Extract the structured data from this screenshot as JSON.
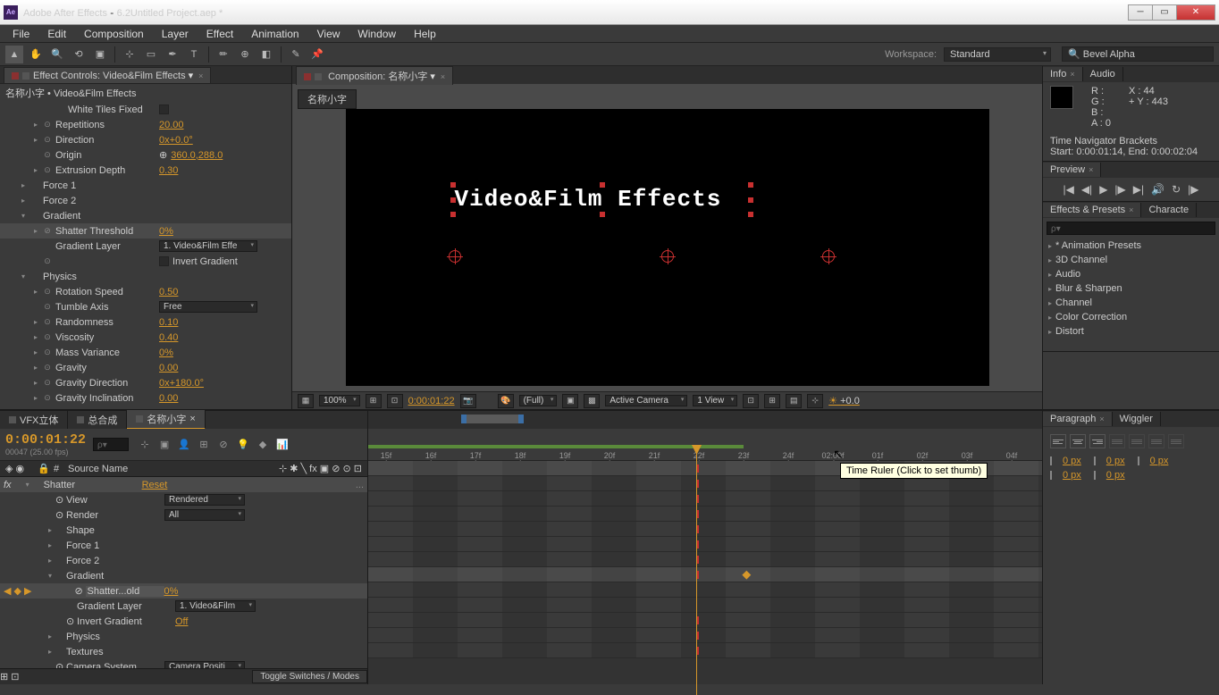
{
  "titlebar": {
    "app": "Adobe After Effects",
    "file": "6.2Untitled Project.aep *"
  },
  "menus": [
    "File",
    "Edit",
    "Composition",
    "Layer",
    "Effect",
    "Animation",
    "View",
    "Window",
    "Help"
  ],
  "toolbar": {
    "workspace_label": "Workspace:",
    "workspace": "Standard",
    "search": "Bevel Alpha"
  },
  "effect_controls": {
    "tab": "Effect Controls: Video&Film Effects",
    "header": "名称小字 • Video&Film Effects",
    "props": [
      {
        "indent": 3,
        "tw": "",
        "sw": "",
        "name": "White Tiles Fixed",
        "valtype": "check"
      },
      {
        "indent": 2,
        "tw": "▸",
        "sw": "⊙",
        "name": "Repetitions",
        "valtype": "hot",
        "val": "20.00"
      },
      {
        "indent": 2,
        "tw": "▸",
        "sw": "⊙",
        "name": "Direction",
        "valtype": "hot",
        "val": "0x+0.0°"
      },
      {
        "indent": 2,
        "tw": "",
        "sw": "⊙",
        "name": "Origin",
        "valtype": "origin",
        "val": "360.0,288.0"
      },
      {
        "indent": 2,
        "tw": "▸",
        "sw": "⊙",
        "name": "Extrusion Depth",
        "valtype": "hot",
        "val": "0.30"
      },
      {
        "indent": 1,
        "tw": "▸",
        "sw": "",
        "name": "Force 1",
        "valtype": "none"
      },
      {
        "indent": 1,
        "tw": "▸",
        "sw": "",
        "name": "Force 2",
        "valtype": "none"
      },
      {
        "indent": 1,
        "tw": "▾",
        "sw": "",
        "name": "Gradient",
        "valtype": "none"
      },
      {
        "indent": 2,
        "tw": "▸",
        "sw": "⊘",
        "name": "Shatter Threshold",
        "valtype": "hot",
        "val": "0%",
        "hi": true
      },
      {
        "indent": 2,
        "tw": "",
        "sw": "",
        "name": "Gradient Layer",
        "valtype": "dd",
        "val": "1. Video&Film Effe"
      },
      {
        "indent": 2,
        "tw": "",
        "sw": "⊙",
        "name": "",
        "valtype": "checklabel",
        "val": "Invert Gradient"
      },
      {
        "indent": 1,
        "tw": "▾",
        "sw": "",
        "name": "Physics",
        "valtype": "none"
      },
      {
        "indent": 2,
        "tw": "▸",
        "sw": "⊙",
        "name": "Rotation Speed",
        "valtype": "hot",
        "val": "0.50"
      },
      {
        "indent": 2,
        "tw": "",
        "sw": "⊙",
        "name": "Tumble Axis",
        "valtype": "dd",
        "val": "Free"
      },
      {
        "indent": 2,
        "tw": "▸",
        "sw": "⊙",
        "name": "Randomness",
        "valtype": "hot",
        "val": "0.10"
      },
      {
        "indent": 2,
        "tw": "▸",
        "sw": "⊙",
        "name": "Viscosity",
        "valtype": "hot",
        "val": "0.40"
      },
      {
        "indent": 2,
        "tw": "▸",
        "sw": "⊙",
        "name": "Mass Variance",
        "valtype": "hot",
        "val": "0%"
      },
      {
        "indent": 2,
        "tw": "▸",
        "sw": "⊙",
        "name": "Gravity",
        "valtype": "hot",
        "val": "0.00"
      },
      {
        "indent": 2,
        "tw": "▸",
        "sw": "⊙",
        "name": "Gravity Direction",
        "valtype": "hot",
        "val": "0x+180.0°"
      },
      {
        "indent": 2,
        "tw": "▸",
        "sw": "⊙",
        "name": "Gravity Inclination",
        "valtype": "hot",
        "val": "0.00"
      }
    ]
  },
  "comp": {
    "tab_prefix": "Composition:",
    "name": "名称小字",
    "text": "Video&Film Effects",
    "footer": {
      "zoom": "100%",
      "time": "0:00:01:22",
      "res": "(Full)",
      "camera": "Active Camera",
      "views": "1 View",
      "exposure": "+0.0"
    }
  },
  "info": {
    "tabs": [
      "Info",
      "Audio"
    ],
    "r": "R :",
    "g": "G :",
    "b": "B :",
    "a": "A : 0",
    "x": "X : 44",
    "y": "Y : 443",
    "nav": "Time Navigator Brackets",
    "nav2": "Start: 0:00:01:14, End: 0:00:02:04"
  },
  "preview": {
    "tab": "Preview"
  },
  "effects_presets": {
    "tabs": [
      "Effects & Presets",
      "Characte"
    ],
    "search": "ρ▾",
    "items": [
      "* Animation Presets",
      "3D Channel",
      "Audio",
      "Blur & Sharpen",
      "Channel",
      "Color Correction",
      "Distort"
    ]
  },
  "paragraph": {
    "tabs": [
      "Paragraph",
      "Wiggler"
    ],
    "indents": [
      "0 px",
      "0 px",
      "0 px",
      "0 px",
      "0 px"
    ]
  },
  "timeline": {
    "tabs": [
      {
        "name": "VFX立体",
        "active": false
      },
      {
        "name": "总合成",
        "active": false
      },
      {
        "name": "名称小字",
        "active": true
      }
    ],
    "timecode": "0:00:01:22",
    "sub": "00047 (25.00 fps)",
    "search": "ρ▾",
    "col_source": "Source Name",
    "ruler": [
      "15f",
      "16f",
      "17f",
      "18f",
      "19f",
      "20f",
      "21f",
      "22f",
      "23f",
      "24f",
      "02:00f",
      "01f",
      "02f",
      "03f",
      "04f"
    ],
    "tooltip": "Time Ruler (Click to set thumb)",
    "rows": [
      {
        "indent": 1,
        "tw": "▾",
        "name": "Shatter",
        "val": "Reset",
        "valtype": "reset",
        "hi": true,
        "fx": true
      },
      {
        "indent": 2,
        "tw": "",
        "sw": "⊙",
        "name": "View",
        "valtype": "dd",
        "val": "Rendered"
      },
      {
        "indent": 2,
        "tw": "",
        "sw": "⊙",
        "name": "Render",
        "valtype": "dd",
        "val": "All"
      },
      {
        "indent": 2,
        "tw": "▸",
        "name": "Shape"
      },
      {
        "indent": 2,
        "tw": "▸",
        "name": "Force 1"
      },
      {
        "indent": 2,
        "tw": "▸",
        "name": "Force 2"
      },
      {
        "indent": 2,
        "tw": "▾",
        "name": "Gradient"
      },
      {
        "indent": 3,
        "tw": "",
        "sw": "⊘",
        "name": "Shatter...old",
        "val": "0%",
        "valtype": "hot",
        "hi": true,
        "kf": true,
        "dia": true
      },
      {
        "indent": 3,
        "tw": "",
        "name": "Gradient Layer",
        "valtype": "dd",
        "val": "1. Video&Film"
      },
      {
        "indent": 3,
        "tw": "",
        "sw": "⊙",
        "name": "Invert Gradient",
        "valtype": "hot",
        "val": "Off"
      },
      {
        "indent": 2,
        "tw": "▸",
        "name": "Physics"
      },
      {
        "indent": 2,
        "tw": "▸",
        "name": "Textures"
      },
      {
        "indent": 2,
        "tw": "",
        "sw": "⊙",
        "name": "Camera System",
        "valtype": "dd",
        "val": "Camera Positi"
      }
    ],
    "toggle": "Toggle Switches / Modes"
  }
}
